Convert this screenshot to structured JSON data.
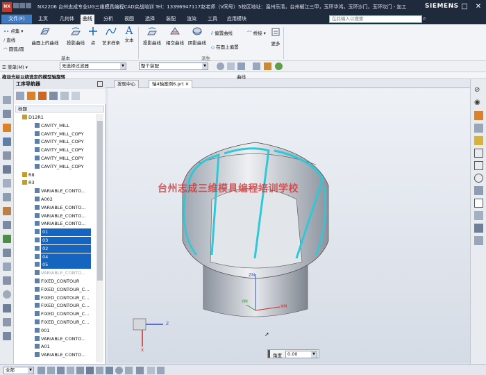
{
  "titlebar": {
    "logo": "NX",
    "title": "NX2206 台州志成专业UG三维模具编程CAD实战培训  Tel：13396947117赵老师（V同号）5校区地址：温州乐清，台州椒江三甲，玉环华鸿，玉环沙门，玉环坎门 - 加工",
    "brand": "SIEMENS"
  },
  "menubar": {
    "file_label": "文件(F)",
    "items": [
      "主页",
      "几何体",
      "曲线",
      "分析",
      "视图",
      "选择",
      "装配",
      "渲染",
      "工具",
      "应用模块"
    ],
    "active_index": 2,
    "search_placeholder": "在此输入以搜索"
  },
  "ribbon": {
    "col1": [
      "点集",
      "直线",
      "圆弧/圆"
    ],
    "big_buttons": [
      "曲面上的曲线",
      "投影曲线",
      "点",
      "艺术样条",
      "文本",
      "投影曲线",
      "相交曲线",
      "阴影曲线"
    ],
    "small_buttons": [
      "偏置曲线",
      "桥接",
      "在面上偏置"
    ],
    "more_label": "更多",
    "group_basic": "基本",
    "group_derived": "派生"
  },
  "strip": {
    "menu_label": "菜单(M)",
    "filter_value": "无选择过滤器",
    "assembly_value": "整个装配",
    "region_label": "曲线"
  },
  "hint": {
    "text": "拖动光标以绕选定的模型轴旋转"
  },
  "navigator": {
    "title": "工序导航器",
    "column_header": "标题",
    "nodes": [
      {
        "label": "D12R1",
        "depth": 0,
        "icon": "folder-icon"
      },
      {
        "label": "CAVITY_MILL",
        "depth": 1,
        "icon": "operation-icon"
      },
      {
        "label": "CAVITY_MILL_COPY",
        "depth": 1,
        "icon": "operation-icon"
      },
      {
        "label": "CAVITY_MILL_COPY",
        "depth": 1,
        "icon": "operation-icon"
      },
      {
        "label": "CAVITY_MILL_COPY",
        "depth": 1,
        "icon": "operation-icon"
      },
      {
        "label": "CAVITY_MILL_COPY",
        "depth": 1,
        "icon": "operation-icon"
      },
      {
        "label": "CAVITY_MILL_COPY",
        "depth": 1,
        "icon": "operation-icon"
      },
      {
        "label": "R8",
        "depth": 0,
        "icon": "folder-icon"
      },
      {
        "label": "R3",
        "depth": 0,
        "icon": "folder-icon"
      },
      {
        "label": "VARIABLE_CONTO...",
        "depth": 1,
        "icon": "operation-icon"
      },
      {
        "label": "A002",
        "depth": 1,
        "icon": "operation-icon"
      },
      {
        "label": "VARIABLE_CONTO...",
        "depth": 1,
        "icon": "operation-icon"
      },
      {
        "label": "VARIABLE_CONTO...",
        "depth": 1,
        "icon": "operation-icon"
      },
      {
        "label": "VARIABLE_CONTO...",
        "depth": 1,
        "icon": "operation-icon"
      },
      {
        "label": "01",
        "depth": 1,
        "icon": "operation-icon",
        "selected": true
      },
      {
        "label": "03",
        "depth": 1,
        "icon": "operation-icon",
        "selected": true
      },
      {
        "label": "02",
        "depth": 1,
        "icon": "operation-icon",
        "selected": true
      },
      {
        "label": "04",
        "depth": 1,
        "icon": "operation-icon",
        "selected": true
      },
      {
        "label": "05",
        "depth": 1,
        "icon": "operation-icon",
        "selected": true
      },
      {
        "label": "VARIABLE_CONTO...",
        "depth": 1,
        "icon": "operation-icon",
        "grey": true
      },
      {
        "label": "FIXED_CONTOUR",
        "depth": 1,
        "icon": "operation-icon"
      },
      {
        "label": "FIXED_CONTOUR_C...",
        "depth": 1,
        "icon": "operation-icon"
      },
      {
        "label": "FIXED_CONTOUR_C...",
        "depth": 1,
        "icon": "operation-icon"
      },
      {
        "label": "FIXED_CONTOUR_C...",
        "depth": 1,
        "icon": "operation-icon"
      },
      {
        "label": "FIXED_CONTOUR_C...",
        "depth": 1,
        "icon": "operation-icon"
      },
      {
        "label": "FIXED_CONTOUR_C...",
        "depth": 1,
        "icon": "operation-icon"
      },
      {
        "label": "001",
        "depth": 1,
        "icon": "operation-icon"
      },
      {
        "label": "VARIABLE_CONTO...",
        "depth": 1,
        "icon": "operation-icon"
      },
      {
        "label": "A01",
        "depth": 1,
        "icon": "operation-icon"
      },
      {
        "label": "VARIABLE_CONTO...",
        "depth": 1,
        "icon": "operation-icon"
      }
    ]
  },
  "tabs": [
    {
      "label": "发现中心"
    },
    {
      "label": "轴4轴案例6.prt"
    }
  ],
  "viewport": {
    "watermark": "台州志成三维模具编程培训学校",
    "axis_zm": "ZM",
    "axis_ym": "YM",
    "axis_xm": "XM",
    "triad_z": "Z",
    "triad_x": "X",
    "angle_label": "角度",
    "angle_value": "0.00"
  },
  "status": {
    "scope_value": "全部"
  },
  "colors": {
    "accent": "#3f7bc4",
    "selection": "#1565c0",
    "toolpath": "#2ec8d8"
  }
}
